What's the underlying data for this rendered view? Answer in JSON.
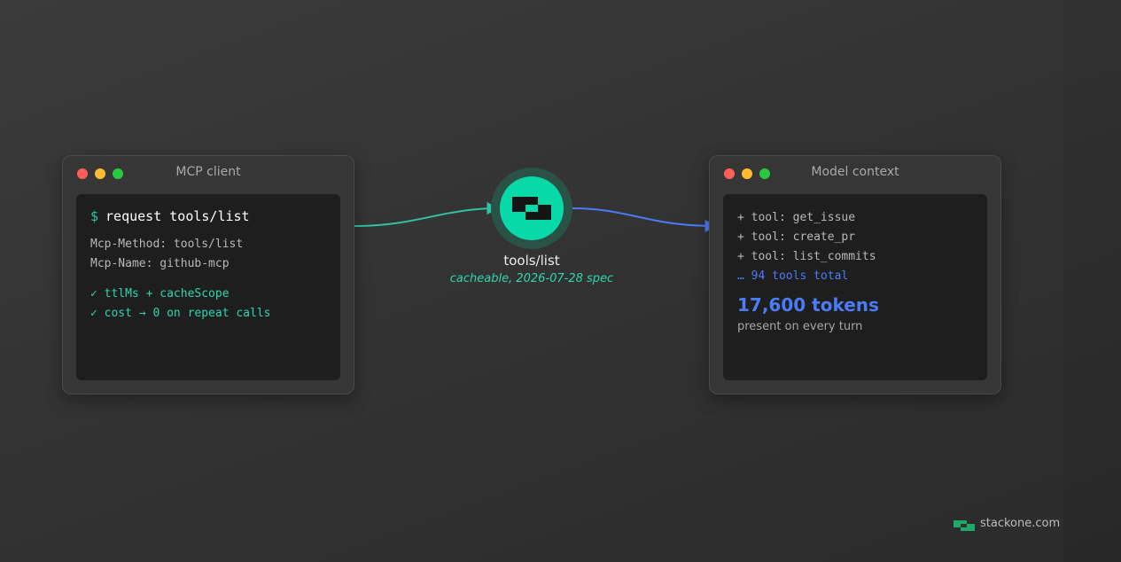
{
  "client_window": {
    "title": "MCP client",
    "prompt_symbol": "$",
    "command": "request tools/list",
    "headers": [
      "Mcp-Method: tools/list",
      "Mcp-Name: github-mcp"
    ],
    "checks": [
      "✓ ttlMs + cacheScope",
      "✓ cost → 0 on repeat calls"
    ]
  },
  "hub": {
    "label": "tools/list",
    "sublabel": "cacheable, 2026-07-28 spec",
    "icon": "stackone-logo-icon"
  },
  "context_window": {
    "title": "Model context",
    "tools": [
      "+ tool: get_issue",
      "+ tool: create_pr",
      "+ tool: list_commits"
    ],
    "tools_more": "… 94 tools total",
    "tokens": "17,600 tokens",
    "tokens_note": "present on every turn"
  },
  "footer": {
    "brand": "stackone.com"
  },
  "colors": {
    "accent_green": "#09d9a9",
    "accent_blue": "#4a7cf6",
    "terminal_bg": "#1e1e1e",
    "window_bg": "#363636"
  }
}
